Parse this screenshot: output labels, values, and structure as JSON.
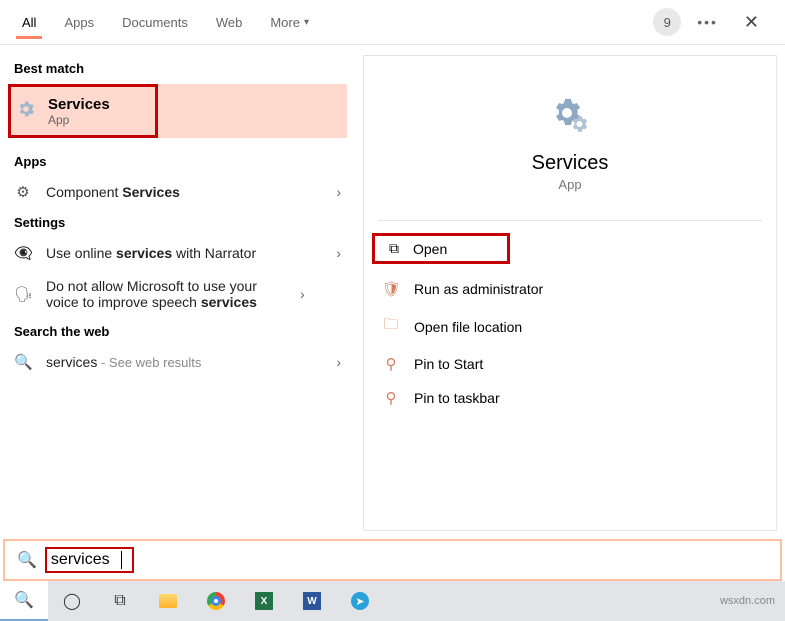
{
  "tabs": {
    "all": "All",
    "apps": "Apps",
    "documents": "Documents",
    "web": "Web",
    "more": "More"
  },
  "badge": "9",
  "sections": {
    "best": "Best match",
    "apps": "Apps",
    "settings": "Settings",
    "web": "Search the web"
  },
  "best_match": {
    "title": "Services",
    "subtitle": "App"
  },
  "apps_list": {
    "component_pre": "Component ",
    "component_bold": "Services"
  },
  "settings_list": {
    "narrator_pre": "Use online ",
    "narrator_bold": "services",
    "narrator_post": " with Narrator",
    "speech_pre": "Do not allow Microsoft to use your voice to improve speech ",
    "speech_bold": "services"
  },
  "web_list": {
    "term": "services",
    "hint": " - See web results"
  },
  "preview": {
    "title": "Services",
    "subtitle": "App",
    "open": "Open",
    "runas": "Run as administrator",
    "loc": "Open file location",
    "pinstart": "Pin to Start",
    "pintask": "Pin to taskbar"
  },
  "search": {
    "value": "services"
  },
  "watermark": "wsxdn.com"
}
